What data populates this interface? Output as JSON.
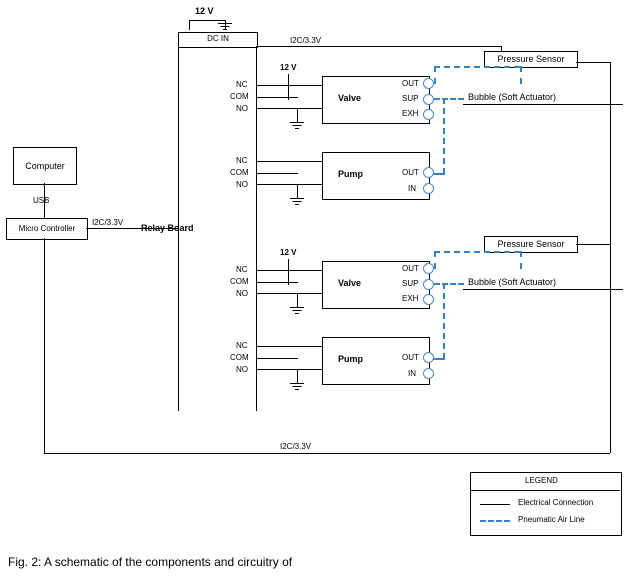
{
  "power12v": "12 V",
  "dcin": "DC IN",
  "bus": "I2C/3.3V",
  "pressure_sensor": "Pressure Sensor",
  "relay": {
    "nc": "NC",
    "com": "COM",
    "no": "NO"
  },
  "valve": {
    "label": "Valve",
    "out": "OUT",
    "sup": "SUP",
    "exh": "EXH"
  },
  "pump": {
    "label": "Pump",
    "out": "OUT",
    "in": "IN"
  },
  "bubble": "Bubble (Soft Actuator)",
  "computer": "Computer",
  "usb": "USB",
  "micro": "Micro Controller",
  "relay_board": "Relay Board",
  "legend": {
    "title": "LEGEND",
    "el": "Electrical Connection",
    "pn": "Pneumatic Air Line"
  },
  "caption": "Fig. 2: A schematic of the components and circuitry of"
}
